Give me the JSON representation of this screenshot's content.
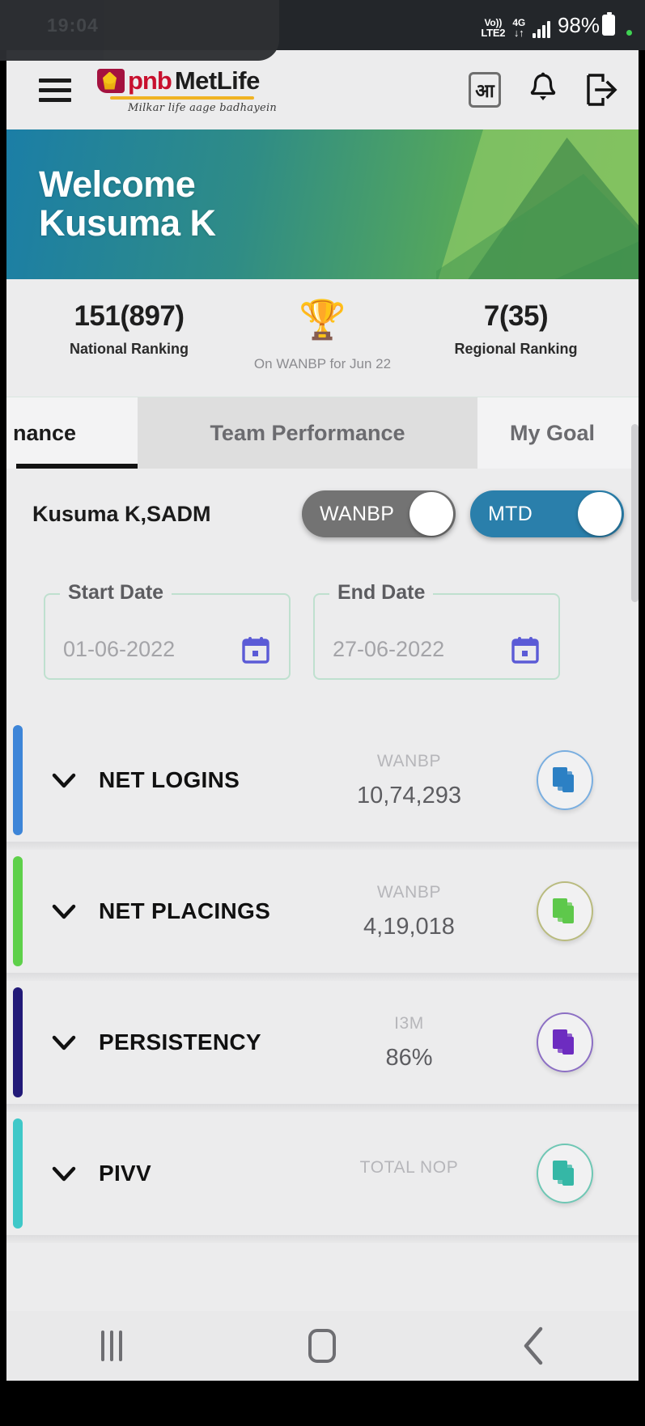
{
  "statusbar": {
    "network_top": "Vo))",
    "network_bottom": "LTE2",
    "data_top": "4G",
    "data_bottom": "↓↑",
    "battery": "98%",
    "clock_ghost": "19:04"
  },
  "appbar": {
    "menu_icon": "hamburger-menu-icon",
    "logo_pnb": "pnb",
    "logo_metlife": "MetLife",
    "logo_tagline": "Milkar life aage badhayein",
    "language_label": "आ",
    "bell_icon": "notification-bell-icon",
    "logout_icon": "logout-icon"
  },
  "banner": {
    "greeting": "Welcome",
    "user_name": "Kusuma K"
  },
  "ranking": {
    "national_value": "151(897)",
    "national_label": "National Ranking",
    "trophy_icon": "🏆",
    "subtitle": "On WANBP for Jun 22",
    "regional_value": "7(35)",
    "regional_label": "Regional Ranking"
  },
  "tabs": [
    {
      "label": "nance",
      "active": true
    },
    {
      "label": "Team Performance",
      "active": false
    },
    {
      "label": "My Goal",
      "active": false
    }
  ],
  "subheader": {
    "name": "Kusuma K,SADM",
    "toggle_wanbp": "WANBP",
    "toggle_mtd": "MTD"
  },
  "filters": {
    "start_label": "Start Date",
    "start_value": "01-06-2022",
    "end_label": "End Date",
    "end_value": "27-06-2022"
  },
  "cards": [
    {
      "title": "NET LOGINS",
      "kpi": "WANBP",
      "value": "10,74,293",
      "accent": "#3d85d8",
      "icon_color": "#2c80c4",
      "ring": "#79aee0"
    },
    {
      "title": "NET PLACINGS",
      "kpi": "WANBP",
      "value": "4,19,018",
      "accent": "#5ed04a",
      "icon_color": "#5ec84b",
      "ring": "#b9bb7e"
    },
    {
      "title": "PERSISTENCY",
      "kpi": "I3M",
      "value": "86%",
      "accent": "#221a78",
      "icon_color": "#6d2cc0",
      "ring": "#8c6fc4"
    },
    {
      "title": "PIVV",
      "kpi": "TOTAL NOP",
      "value": "",
      "accent": "#3fc8c8",
      "icon_color": "#35b7a6",
      "ring": "#6ec7b4"
    }
  ],
  "navbar": {
    "recents": "recents-icon",
    "home": "home-icon",
    "back": "back-icon"
  }
}
